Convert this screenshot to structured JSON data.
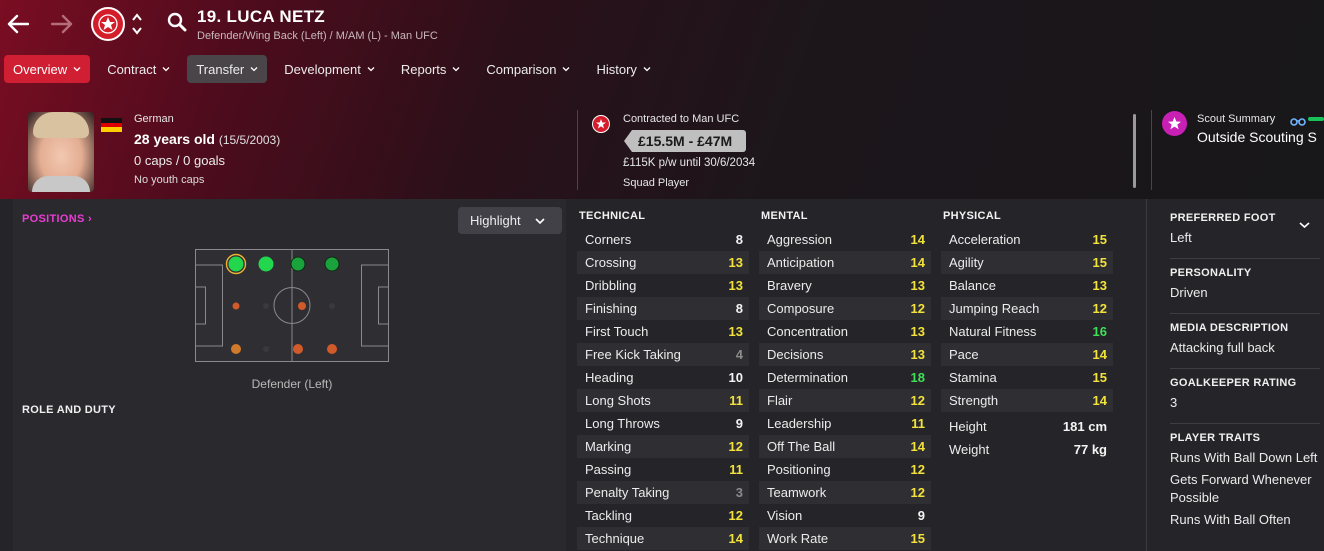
{
  "header": {
    "player_name": "19. LUCA NETZ",
    "player_position": "Defender/Wing Back (Left) / M/AM (L) - Man UFC"
  },
  "tabs": [
    {
      "label": "Overview",
      "state": "active"
    },
    {
      "label": "Contract",
      "state": "normal"
    },
    {
      "label": "Transfer",
      "state": "hover"
    },
    {
      "label": "Development",
      "state": "normal"
    },
    {
      "label": "Reports",
      "state": "normal"
    },
    {
      "label": "Comparison",
      "state": "normal"
    },
    {
      "label": "History",
      "state": "normal"
    }
  ],
  "bio": {
    "nationality": "German",
    "age": "28 years old",
    "dob": "(15/5/2003)",
    "caps_goals": "0 caps / 0 goals",
    "youth": "No youth caps"
  },
  "contract": {
    "status": "Contracted to Man UFC",
    "value": "£15.5M - £47M",
    "wage": "£115K p/w until 30/6/2034",
    "squad_status": "Squad Player"
  },
  "scout": {
    "title": "Scout Summary",
    "value": "Outside Scouting S"
  },
  "positions": {
    "link": "POSITIONS",
    "highlight_label": "Highlight",
    "pitch_label": "Defender (Left)",
    "role_title": "ROLE AND DUTY"
  },
  "attributes": {
    "technical": {
      "title": "TECHNICAL",
      "rows": [
        {
          "name": "Corners",
          "value": "8",
          "tone": "white"
        },
        {
          "name": "Crossing",
          "value": "13",
          "tone": "yellow"
        },
        {
          "name": "Dribbling",
          "value": "13",
          "tone": "yellow"
        },
        {
          "name": "Finishing",
          "value": "8",
          "tone": "white"
        },
        {
          "name": "First Touch",
          "value": "13",
          "tone": "yellow"
        },
        {
          "name": "Free Kick Taking",
          "value": "4",
          "tone": "grey"
        },
        {
          "name": "Heading",
          "value": "10",
          "tone": "white"
        },
        {
          "name": "Long Shots",
          "value": "11",
          "tone": "yellow"
        },
        {
          "name": "Long Throws",
          "value": "9",
          "tone": "white"
        },
        {
          "name": "Marking",
          "value": "12",
          "tone": "yellow"
        },
        {
          "name": "Passing",
          "value": "11",
          "tone": "yellow"
        },
        {
          "name": "Penalty Taking",
          "value": "3",
          "tone": "grey"
        },
        {
          "name": "Tackling",
          "value": "12",
          "tone": "yellow"
        },
        {
          "name": "Technique",
          "value": "14",
          "tone": "yellow"
        }
      ]
    },
    "mental": {
      "title": "MENTAL",
      "rows": [
        {
          "name": "Aggression",
          "value": "14",
          "tone": "yellow"
        },
        {
          "name": "Anticipation",
          "value": "14",
          "tone": "yellow"
        },
        {
          "name": "Bravery",
          "value": "13",
          "tone": "yellow"
        },
        {
          "name": "Composure",
          "value": "12",
          "tone": "yellow"
        },
        {
          "name": "Concentration",
          "value": "13",
          "tone": "yellow"
        },
        {
          "name": "Decisions",
          "value": "13",
          "tone": "yellow"
        },
        {
          "name": "Determination",
          "value": "18",
          "tone": "green"
        },
        {
          "name": "Flair",
          "value": "12",
          "tone": "yellow"
        },
        {
          "name": "Leadership",
          "value": "11",
          "tone": "yellow"
        },
        {
          "name": "Off The Ball",
          "value": "14",
          "tone": "yellow"
        },
        {
          "name": "Positioning",
          "value": "12",
          "tone": "yellow"
        },
        {
          "name": "Teamwork",
          "value": "12",
          "tone": "yellow"
        },
        {
          "name": "Vision",
          "value": "9",
          "tone": "white"
        },
        {
          "name": "Work Rate",
          "value": "15",
          "tone": "yellow"
        }
      ]
    },
    "physical": {
      "title": "PHYSICAL",
      "rows": [
        {
          "name": "Acceleration",
          "value": "15",
          "tone": "yellow"
        },
        {
          "name": "Agility",
          "value": "15",
          "tone": "yellow"
        },
        {
          "name": "Balance",
          "value": "13",
          "tone": "yellow"
        },
        {
          "name": "Jumping Reach",
          "value": "12",
          "tone": "yellow"
        },
        {
          "name": "Natural Fitness",
          "value": "16",
          "tone": "green"
        },
        {
          "name": "Pace",
          "value": "14",
          "tone": "yellow"
        },
        {
          "name": "Stamina",
          "value": "15",
          "tone": "yellow"
        },
        {
          "name": "Strength",
          "value": "14",
          "tone": "yellow"
        }
      ],
      "height_label": "Height",
      "height_value": "181 cm",
      "weight_label": "Weight",
      "weight_value": "77 kg"
    }
  },
  "info": {
    "preferred_foot_title": "PREFERRED FOOT",
    "preferred_foot": "Left",
    "personality_title": "PERSONALITY",
    "personality": "Driven",
    "media_title": "MEDIA DESCRIPTION",
    "media": "Attacking full back",
    "gk_title": "GOALKEEPER RATING",
    "gk": "3",
    "traits_title": "PLAYER TRAITS",
    "traits": [
      "Runs With Ball Down Left",
      "Gets Forward Whenever Possible",
      "Runs With Ball Often"
    ]
  },
  "colors": {
    "accent": "#d01f33",
    "positions_link": "#e93cd4",
    "attr_yellow": "#f2e23b",
    "attr_green": "#3ee055"
  }
}
